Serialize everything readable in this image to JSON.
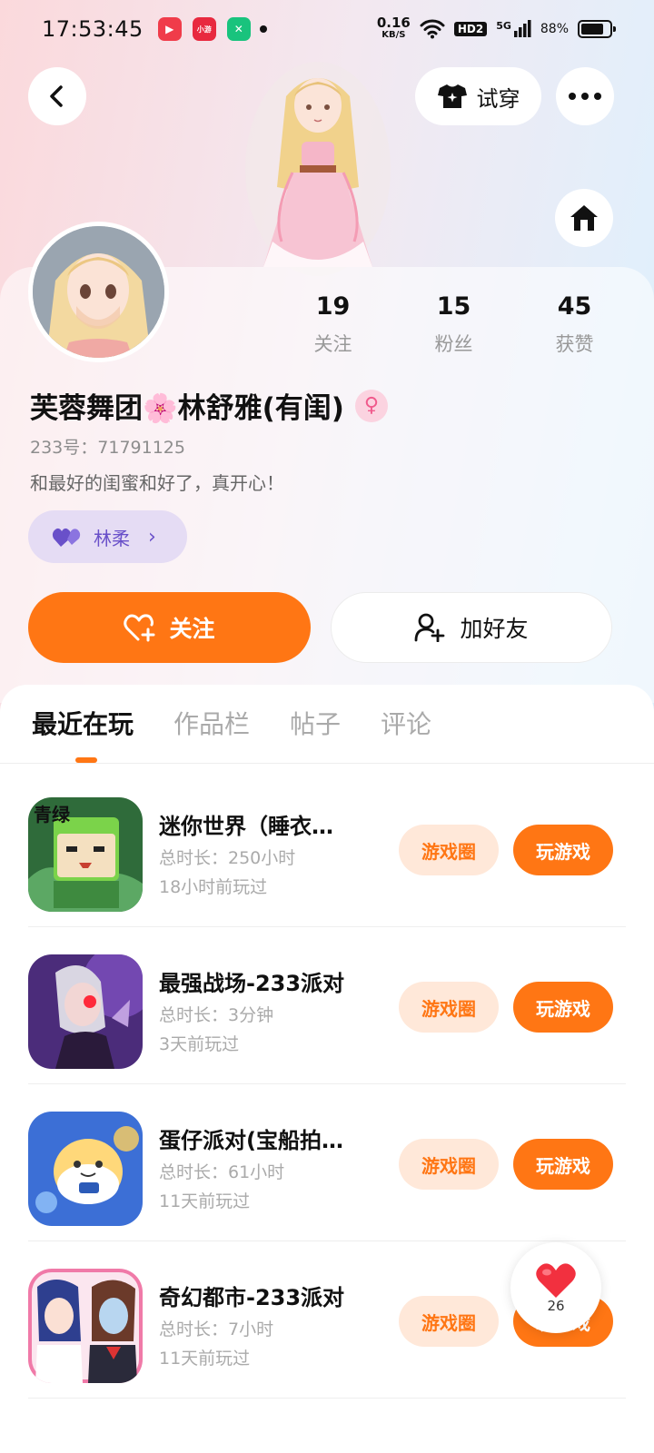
{
  "status_bar": {
    "time": "17:53:45",
    "netspeed_value": "0.16",
    "netspeed_unit": "KB/S",
    "hd_label": "HD2",
    "signal_label": "5G",
    "battery": "88%"
  },
  "header": {
    "try_on_label": "试穿"
  },
  "profile": {
    "nickname": "芙蓉舞团🌸林舒雅(有闺)",
    "gender_symbol": "♀",
    "user_id": "233号：71791125",
    "bio": "和最好的闺蜜和好了，真开心！",
    "relation_name": "林柔",
    "stats": [
      {
        "value": "19",
        "label": "关注"
      },
      {
        "value": "15",
        "label": "粉丝"
      },
      {
        "value": "45",
        "label": "获赞"
      }
    ]
  },
  "actions": {
    "follow_label": "关注",
    "add_friend_label": "加好友"
  },
  "tabs": [
    {
      "label": "最近在玩",
      "active": true
    },
    {
      "label": "作品栏",
      "active": false
    },
    {
      "label": "帖子",
      "active": false
    },
    {
      "label": "评论",
      "active": false
    }
  ],
  "games": [
    {
      "title": "迷你世界（睡衣…",
      "duration": "总时长：250小时",
      "last_played": "18小时前玩过",
      "circle_label": "游戏圈",
      "play_label": "玩游戏",
      "icon": "mini-world-game-icon"
    },
    {
      "title": "最强战场-233派对",
      "duration": "总时长：3分钟",
      "last_played": "3天前玩过",
      "circle_label": "游戏圈",
      "play_label": "玩游戏",
      "icon": "battlefield-game-icon"
    },
    {
      "title": "蛋仔派对(宝船拍…",
      "duration": "总时长：61小时",
      "last_played": "11天前玩过",
      "circle_label": "游戏圈",
      "play_label": "玩游戏",
      "icon": "eggy-party-game-icon"
    },
    {
      "title": "奇幻都市-233派对",
      "duration": "总时长：7小时",
      "last_played": "11天前玩过",
      "circle_label": "游戏圈",
      "play_label": "玩游戏",
      "icon": "fantasy-city-game-icon"
    }
  ],
  "like_float": {
    "count": "26"
  },
  "colors": {
    "accent": "#ff7614",
    "accent_light": "#ffe8d9",
    "relation_bg": "#e5dcf4",
    "relation_text": "#6950c9"
  }
}
